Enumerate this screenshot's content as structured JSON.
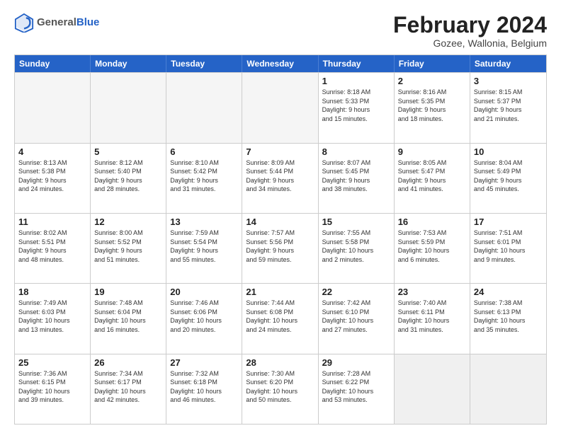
{
  "logo": {
    "general": "General",
    "blue": "Blue"
  },
  "title": {
    "main": "February 2024",
    "sub": "Gozee, Wallonia, Belgium"
  },
  "weekdays": [
    "Sunday",
    "Monday",
    "Tuesday",
    "Wednesday",
    "Thursday",
    "Friday",
    "Saturday"
  ],
  "rows": [
    [
      {
        "day": "",
        "info": "",
        "empty": true
      },
      {
        "day": "",
        "info": "",
        "empty": true
      },
      {
        "day": "",
        "info": "",
        "empty": true
      },
      {
        "day": "",
        "info": "",
        "empty": true
      },
      {
        "day": "1",
        "info": "Sunrise: 8:18 AM\nSunset: 5:33 PM\nDaylight: 9 hours\nand 15 minutes."
      },
      {
        "day": "2",
        "info": "Sunrise: 8:16 AM\nSunset: 5:35 PM\nDaylight: 9 hours\nand 18 minutes."
      },
      {
        "day": "3",
        "info": "Sunrise: 8:15 AM\nSunset: 5:37 PM\nDaylight: 9 hours\nand 21 minutes."
      }
    ],
    [
      {
        "day": "4",
        "info": "Sunrise: 8:13 AM\nSunset: 5:38 PM\nDaylight: 9 hours\nand 24 minutes."
      },
      {
        "day": "5",
        "info": "Sunrise: 8:12 AM\nSunset: 5:40 PM\nDaylight: 9 hours\nand 28 minutes."
      },
      {
        "day": "6",
        "info": "Sunrise: 8:10 AM\nSunset: 5:42 PM\nDaylight: 9 hours\nand 31 minutes."
      },
      {
        "day": "7",
        "info": "Sunrise: 8:09 AM\nSunset: 5:44 PM\nDaylight: 9 hours\nand 34 minutes."
      },
      {
        "day": "8",
        "info": "Sunrise: 8:07 AM\nSunset: 5:45 PM\nDaylight: 9 hours\nand 38 minutes."
      },
      {
        "day": "9",
        "info": "Sunrise: 8:05 AM\nSunset: 5:47 PM\nDaylight: 9 hours\nand 41 minutes."
      },
      {
        "day": "10",
        "info": "Sunrise: 8:04 AM\nSunset: 5:49 PM\nDaylight: 9 hours\nand 45 minutes."
      }
    ],
    [
      {
        "day": "11",
        "info": "Sunrise: 8:02 AM\nSunset: 5:51 PM\nDaylight: 9 hours\nand 48 minutes."
      },
      {
        "day": "12",
        "info": "Sunrise: 8:00 AM\nSunset: 5:52 PM\nDaylight: 9 hours\nand 51 minutes."
      },
      {
        "day": "13",
        "info": "Sunrise: 7:59 AM\nSunset: 5:54 PM\nDaylight: 9 hours\nand 55 minutes."
      },
      {
        "day": "14",
        "info": "Sunrise: 7:57 AM\nSunset: 5:56 PM\nDaylight: 9 hours\nand 59 minutes."
      },
      {
        "day": "15",
        "info": "Sunrise: 7:55 AM\nSunset: 5:58 PM\nDaylight: 10 hours\nand 2 minutes."
      },
      {
        "day": "16",
        "info": "Sunrise: 7:53 AM\nSunset: 5:59 PM\nDaylight: 10 hours\nand 6 minutes."
      },
      {
        "day": "17",
        "info": "Sunrise: 7:51 AM\nSunset: 6:01 PM\nDaylight: 10 hours\nand 9 minutes."
      }
    ],
    [
      {
        "day": "18",
        "info": "Sunrise: 7:49 AM\nSunset: 6:03 PM\nDaylight: 10 hours\nand 13 minutes."
      },
      {
        "day": "19",
        "info": "Sunrise: 7:48 AM\nSunset: 6:04 PM\nDaylight: 10 hours\nand 16 minutes."
      },
      {
        "day": "20",
        "info": "Sunrise: 7:46 AM\nSunset: 6:06 PM\nDaylight: 10 hours\nand 20 minutes."
      },
      {
        "day": "21",
        "info": "Sunrise: 7:44 AM\nSunset: 6:08 PM\nDaylight: 10 hours\nand 24 minutes."
      },
      {
        "day": "22",
        "info": "Sunrise: 7:42 AM\nSunset: 6:10 PM\nDaylight: 10 hours\nand 27 minutes."
      },
      {
        "day": "23",
        "info": "Sunrise: 7:40 AM\nSunset: 6:11 PM\nDaylight: 10 hours\nand 31 minutes."
      },
      {
        "day": "24",
        "info": "Sunrise: 7:38 AM\nSunset: 6:13 PM\nDaylight: 10 hours\nand 35 minutes."
      }
    ],
    [
      {
        "day": "25",
        "info": "Sunrise: 7:36 AM\nSunset: 6:15 PM\nDaylight: 10 hours\nand 39 minutes."
      },
      {
        "day": "26",
        "info": "Sunrise: 7:34 AM\nSunset: 6:17 PM\nDaylight: 10 hours\nand 42 minutes."
      },
      {
        "day": "27",
        "info": "Sunrise: 7:32 AM\nSunset: 6:18 PM\nDaylight: 10 hours\nand 46 minutes."
      },
      {
        "day": "28",
        "info": "Sunrise: 7:30 AM\nSunset: 6:20 PM\nDaylight: 10 hours\nand 50 minutes."
      },
      {
        "day": "29",
        "info": "Sunrise: 7:28 AM\nSunset: 6:22 PM\nDaylight: 10 hours\nand 53 minutes."
      },
      {
        "day": "",
        "info": "",
        "empty": true,
        "shaded": true
      },
      {
        "day": "",
        "info": "",
        "empty": true,
        "shaded": true
      }
    ]
  ]
}
